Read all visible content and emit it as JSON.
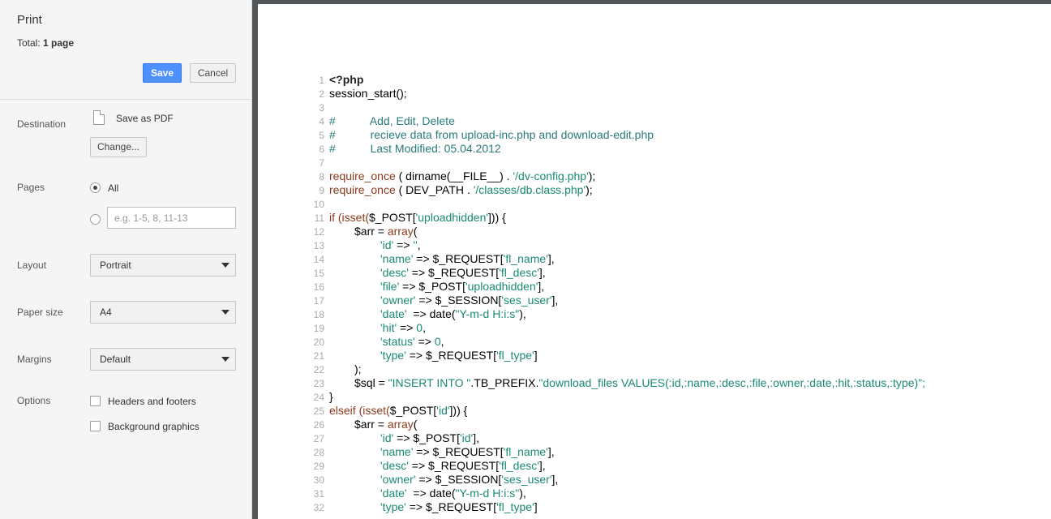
{
  "panel": {
    "title": "Print",
    "total_prefix": "Total: ",
    "total_value": "1 page",
    "save_label": "Save",
    "cancel_label": "Cancel",
    "destination": {
      "label": "Destination",
      "name": "Save as PDF",
      "change_label": "Change..."
    },
    "pages": {
      "label": "Pages",
      "all_label": "All",
      "custom_placeholder": "e.g. 1-5, 8, 11-13"
    },
    "layout": {
      "label": "Layout",
      "value": "Portrait"
    },
    "paper_size": {
      "label": "Paper size",
      "value": "A4"
    },
    "margins": {
      "label": "Margins",
      "value": "Default"
    },
    "options": {
      "label": "Options",
      "headers_footers": "Headers and footers",
      "background_graphics": "Background graphics"
    }
  },
  "code": {
    "lines": [
      {
        "n": "1",
        "t": "<?php"
      },
      {
        "n": "2",
        "t": "session_start();"
      },
      {
        "n": "3",
        "t": ""
      },
      {
        "n": "4",
        "t": "#           Add, Edit, Delete"
      },
      {
        "n": "5",
        "t": "#           recieve data from upload-inc.php and download-edit.php"
      },
      {
        "n": "6",
        "t": "#           Last Modified: 05.04.2012"
      },
      {
        "n": "7",
        "t": ""
      },
      {
        "n": "8",
        "a": "require_once",
        "b": " ( dirname(__FILE__) . ",
        "c": "'/dv-config.php'",
        "d": ");"
      },
      {
        "n": "9",
        "a": "require_once",
        "b": " ( DEV_PATH . ",
        "c": "'/classes/db.class.php'",
        "d": ");"
      },
      {
        "n": "10",
        "t": ""
      },
      {
        "n": "11",
        "a": "if (isset(",
        "b": "$_POST[",
        "c": "'uploadhidden'",
        "d": "])) {"
      },
      {
        "n": "12",
        "a": "$arr = ",
        "b": "array",
        "c": "(",
        "d": ""
      },
      {
        "n": "13",
        "a": "'id'",
        "b": " => ",
        "c": "''",
        "d": ","
      },
      {
        "n": "14",
        "a": "'name'",
        "b": " => $_REQUEST[",
        "c": "'fl_name'",
        "d": "],"
      },
      {
        "n": "15",
        "a": "'desc'",
        "b": " => $_REQUEST[",
        "c": "'fl_desc'",
        "d": "],"
      },
      {
        "n": "16",
        "a": "'file'",
        "b": " => $_POST[",
        "c": "'uploadhidden'",
        "d": "],"
      },
      {
        "n": "17",
        "a": "'owner'",
        "b": " => $_SESSION[",
        "c": "'ses_user'",
        "d": "],"
      },
      {
        "n": "18",
        "a": "'date'",
        "b": "  => date(",
        "c": "\"Y-m-d H:i:s\"",
        "d": "),"
      },
      {
        "n": "19",
        "a": "'hit'",
        "b": " => ",
        "c": "0",
        "d": ","
      },
      {
        "n": "20",
        "a": "'status'",
        "b": " => ",
        "c": "0",
        "d": ","
      },
      {
        "n": "21",
        "a": "'type'",
        "b": " => $_REQUEST[",
        "c": "'fl_type'",
        "d": "]"
      },
      {
        "n": "22",
        "t": ");"
      },
      {
        "n": "23",
        "a": "$sql = ",
        "b": "\"INSERT INTO \"",
        "c": ".TB_PREFIX.",
        "d": "\"download_files VALUES(:id,:name,:desc,:file,:owner,:date,:hit,:status,:type)\";"
      },
      {
        "n": "24",
        "t": "}"
      },
      {
        "n": "25",
        "a": "elseif (isset(",
        "b": "$_POST[",
        "c": "'id'",
        "d": "])) {"
      },
      {
        "n": "26",
        "a": "$arr = ",
        "b": "array",
        "c": "(",
        "d": ""
      },
      {
        "n": "27",
        "a": "'id'",
        "b": " => $_POST[",
        "c": "'id'",
        "d": "],"
      },
      {
        "n": "28",
        "a": "'name'",
        "b": " => $_REQUEST[",
        "c": "'fl_name'",
        "d": "],"
      },
      {
        "n": "29",
        "a": "'desc'",
        "b": " => $_REQUEST[",
        "c": "'fl_desc'",
        "d": "],"
      },
      {
        "n": "30",
        "a": "'owner'",
        "b": " => $_SESSION[",
        "c": "'ses_user'",
        "d": "],"
      },
      {
        "n": "31",
        "a": "'date'",
        "b": "  => date(",
        "c": "\"Y-m-d H:i:s\"",
        "d": "),"
      },
      {
        "n": "32",
        "a": "'type'",
        "b": " => $_REQUEST[",
        "c": "'fl_type'",
        "d": "]"
      }
    ]
  }
}
